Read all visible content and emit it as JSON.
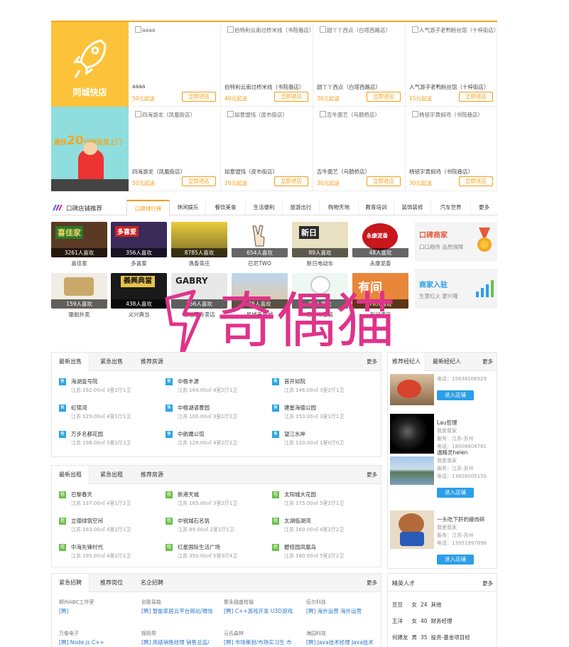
{
  "colors": {
    "accent": "#f39c12",
    "blue": "#2a9ee8",
    "sale_tag": "#2aa6e0",
    "rent_tag": "#6cc04a",
    "hero_yellow": "#fcc33a"
  },
  "hero": {
    "title": "同城快店",
    "promo_pre": "最快",
    "promo_num": "20",
    "promo_post": "分钟送货上门"
  },
  "shops": [
    {
      "img": "aaaa",
      "name": "aaaa",
      "price": "50元起送",
      "btn": "立即进店"
    },
    {
      "img": "伯特利云南过桥米线（书院巷店）",
      "name": "伯特利云南过桥米线（书院巷店）",
      "price": "40元起送",
      "btn": "立即进店"
    },
    {
      "img": "甜丫丫西点（白塔西路店）",
      "name": "甜丫丫西点（白塔西路店）",
      "price": "30元起送",
      "btn": "立即进店"
    },
    {
      "img": "人气游子老鸭粉丝馆（十梓街店）",
      "name": "人气游子老鸭粉丝馆（十梓街店）",
      "price": "15元起送",
      "btn": "立即进店"
    },
    {
      "img": "四海游龙（凤凰街店）",
      "name": "四海游龙（凤凰街店）",
      "price": "50元起送",
      "btn": "立即进店"
    },
    {
      "img": "如意馄饨（皮市街店）",
      "name": "如意馄饨（皮市街店）",
      "price": "20元起送",
      "btn": "立即进店"
    },
    {
      "img": "吉牛面艺（乌鹊桥店）",
      "name": "吉牛面艺（乌鹊桥店）",
      "price": "30元起送",
      "btn": "立即进店"
    },
    {
      "img": "杨铭宇黄焖鸡（书院巷店）",
      "name": "杨铭宇黄焖鸡（书院巷店）",
      "price": "30元起送",
      "btn": "立即进店"
    }
  ],
  "shop_tabs": {
    "title": "口碑店铺推荐",
    "tabs": [
      "口碑排行榜",
      "休闲娱乐",
      "餐饮美食",
      "生活便利",
      "旅游出行",
      "购物天地",
      "教育培训",
      "装饰装修",
      "汽车世界"
    ],
    "more": "更多"
  },
  "rank_row1": [
    {
      "count": "3261人喜欢",
      "name": "喜佳家",
      "sign": "喜佳家"
    },
    {
      "count": "356人喜欢",
      "name": "多喜爱",
      "sign": "多喜爱"
    },
    {
      "count": "8785人喜欢",
      "name": "逸香茶庄",
      "sign": ""
    },
    {
      "count": "654人喜欢",
      "name": "已尼TWO",
      "sign": ""
    },
    {
      "count": "89人喜欢",
      "name": "新日电动车",
      "sign": "新日"
    },
    {
      "count": "48人喜欢",
      "name": "永康泥香",
      "sign": "永康泥香"
    }
  ],
  "rank_row2": [
    {
      "count": "159人喜欢",
      "name": "珊姐外卖",
      "sign": ""
    },
    {
      "count": "438人喜欢",
      "name": "义兴典当",
      "sign": "義興典當"
    },
    {
      "count": "356人喜欢",
      "name": "嘉柏丽专卖店",
      "sign": "GABRY"
    },
    {
      "count": "35人喜欢",
      "name": "星城美食城",
      "sign": ""
    },
    {
      "count": "96人喜欢",
      "name": "喜羊羊童装",
      "sign": ""
    },
    {
      "count": "78人喜欢",
      "name": "有间酒店",
      "sign": "有间"
    }
  ],
  "side_promos": [
    {
      "title": "口碑商家",
      "sub": "口口相传 品质保障"
    },
    {
      "title": "商家入驻",
      "sub": "生意红火 更兴隆"
    }
  ],
  "watermark": "奇偶猫",
  "sale": {
    "tabs": [
      "最新出售",
      "紧急出售",
      "推荐房源"
    ],
    "more": "更多",
    "tag": "售",
    "items": [
      {
        "t": "海湖壹号院",
        "d": "江苏 162.00㎡ 3室2厅1卫"
      },
      {
        "t": "中梧丰源",
        "d": "江苏 164.00㎡ 4室2厅1卫"
      },
      {
        "t": "首开如院",
        "d": "江苏 146.00㎡ 3室2厅1卫"
      },
      {
        "t": "虹锦湾",
        "d": "江苏 129.00㎡ 4室1厅1卫"
      },
      {
        "t": "中梧湖语曹园",
        "d": "江苏 100.00㎡ 3室1厅2卫"
      },
      {
        "t": "建星海德公园",
        "d": "江苏 150.00㎡ 3室1厅1卫"
      },
      {
        "t": "万步名都花园",
        "d": "江苏 198.00㎡ 5室2厅3卫"
      },
      {
        "t": "中航媚公馆",
        "d": "江苏 128.00㎡ 4室2厅2卫"
      },
      {
        "t": "望江水岸",
        "d": "江苏 120.00㎡ 1室0厅0卫"
      }
    ]
  },
  "rent": {
    "tabs": [
      "最新出租",
      "紧急出租",
      "推荐房源"
    ],
    "more": "更多",
    "tag": "租",
    "items": [
      {
        "t": "巴黎春天",
        "d": "江苏 137.00㎡ 4室1厅2卫"
      },
      {
        "t": "新港天城",
        "d": "江苏 165.00㎡ 3室2厅1卫"
      },
      {
        "t": "太阳城大花园",
        "d": "江苏 175.00㎡ 5室2厅1卫"
      },
      {
        "t": "立德绿筑空间",
        "d": "江苏 183.00㎡ 4室2厅1卫"
      },
      {
        "t": "中锐城石名筑",
        "d": "江苏 89.00㎡ 2室1厅1卫"
      },
      {
        "t": "太湖临湖湾",
        "d": "江苏 160.00㎡ 4室2厅2卫"
      },
      {
        "t": "中海先锋时代",
        "d": "江苏 195.00㎡ 4室2厅2卫"
      },
      {
        "t": "红星国际生活广场",
        "d": "江苏 350.00㎡ 5室3厅4卫"
      },
      {
        "t": "碧桂园凤凰岛",
        "d": "江苏 180.00㎡ 5室2厅2卫"
      }
    ]
  },
  "jobs": {
    "tabs": [
      "紧急招聘",
      "推荐岗位",
      "名企招聘"
    ],
    "more": "更多",
    "items": [
      {
        "c": "柳州ABC工作室",
        "r": "[聘]"
      },
      {
        "c": "创联易能",
        "r": "[聘] 智能家居云平台网站/微信"
      },
      {
        "c": "聚永融盛柑猫",
        "r": "[聘] C++游戏开发 U3D游戏"
      },
      {
        "c": "伍尔科技",
        "r": "[聘] 海外运营 海外运营"
      },
      {
        "c": "万像电子",
        "r": "[聘] Node.js C++"
      },
      {
        "c": "锦妈帮",
        "r": "[聘] 高级销售经理 销售总监/"
      },
      {
        "c": "元氏森林",
        "r": "[聘] 市场策划/市场实习生 市"
      },
      {
        "c": "海园科技",
        "r": "[聘] Java技术经理 Java技术"
      }
    ]
  },
  "agents": {
    "tabs": [
      "推荐经纪人",
      "最新经纪人"
    ],
    "more": "更多",
    "list": [
      {
        "name": "",
        "desc": "",
        "area": "",
        "phone": "电话：15838106929",
        "btn": "进入店铺"
      },
      {
        "name": "Lau哲理",
        "desc": "我爱我家",
        "area": "服务：江苏-苏州",
        "phone": "电话：18008808781",
        "btn": ""
      },
      {
        "name": "温精灵helen",
        "desc": "我爱我家",
        "area": "服务：江苏-苏州",
        "phone": "电话：13826005150",
        "btn": "进入店铺"
      },
      {
        "name": "一头吃下肝的瘦肉碎",
        "desc": "我爱我家",
        "area": "服务：江苏-苏州",
        "phone": "电话：13951997896",
        "btn": "进入店铺"
      }
    ]
  },
  "talent": {
    "title": "精英人才",
    "more": "更多",
    "rows": [
      [
        "豆豆",
        "女",
        "24",
        "其他"
      ],
      [
        "王洋",
        "女",
        "40",
        "财务经理"
      ],
      [
        "何建友",
        "男",
        "35",
        "投资-基金项目经"
      ]
    ]
  }
}
